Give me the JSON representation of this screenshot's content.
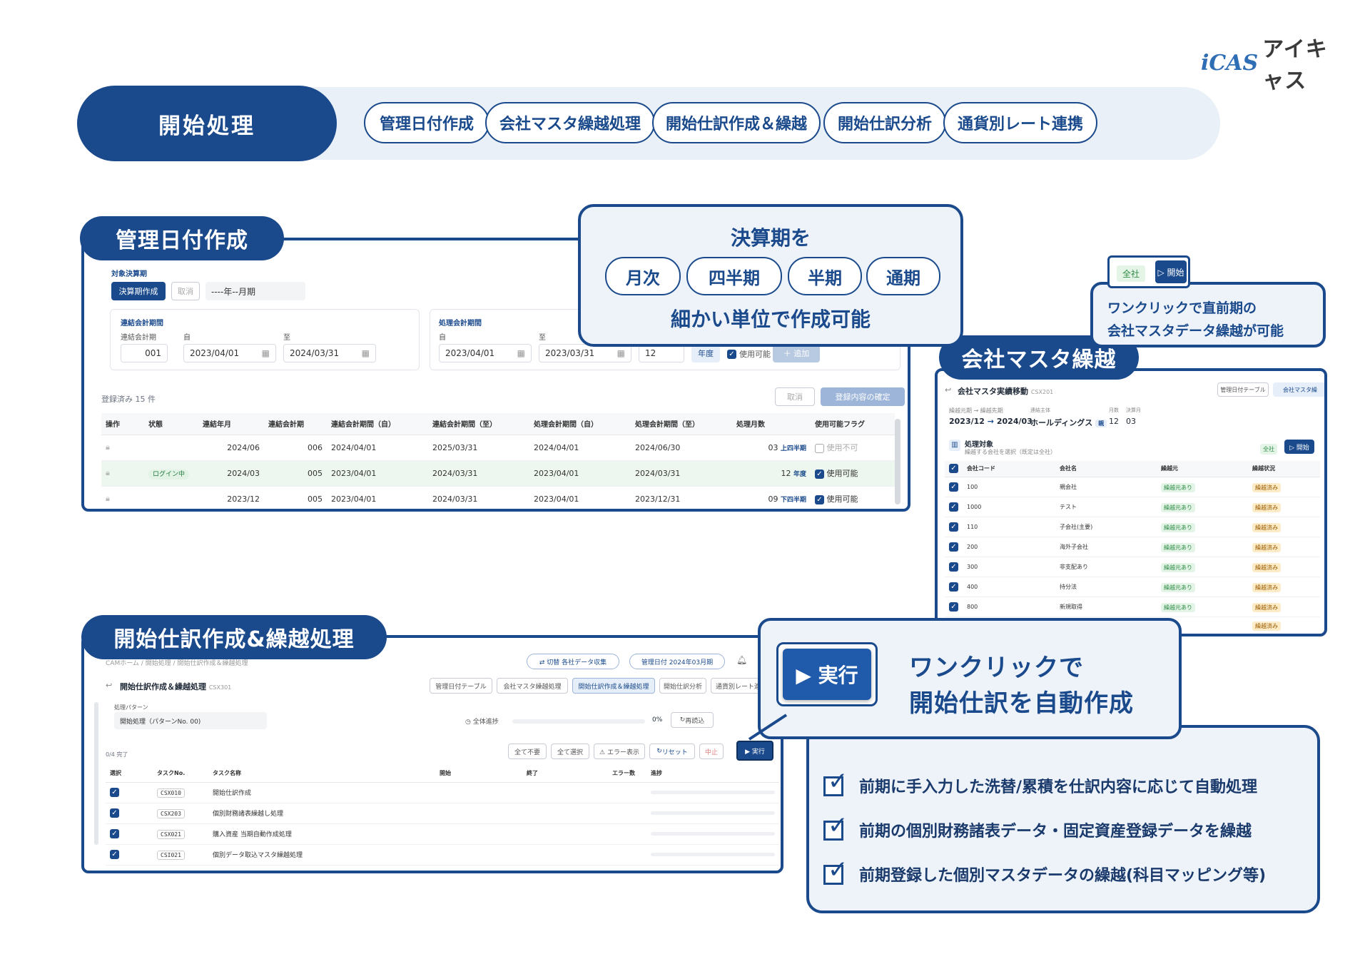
{
  "brand": {
    "mark": "iCAS",
    "name": "アイキャス"
  },
  "header": {
    "title": "開始処理",
    "tags": [
      "管理日付作成",
      "会社マスタ繰越処理",
      "開始仕訳作成＆繰越",
      "開始仕訳分析",
      "通貨別レート連携"
    ]
  },
  "s1": {
    "title": "管理日付作成",
    "target_label": "対象決算期",
    "create_btn": "決算期作成",
    "cancel_btn": "取消",
    "period_placeholder": "----年--月期",
    "consol_group": "連結会計期間",
    "consol_no_label": "連結会計期",
    "from_label": "自",
    "to_label": "至",
    "consol_no": "001",
    "consol_from": "2023/04/01",
    "consol_to": "2024/03/31",
    "proc_group": "処理会計期間",
    "proc_from": "2023/04/01",
    "proc_to": "2023/03/31",
    "months": "12",
    "year_btn": "年度",
    "usable_label": "使用可能",
    "add_btn": "＋ 追加",
    "count": "登録済み 15 件",
    "undo_btn": "取消",
    "confirm_btn": "登録内容の確定",
    "columns": [
      "操作",
      "状態",
      "連結年月",
      "連結会計期",
      "連結会計期間（自）",
      "連結会計期間（至）",
      "処理会計期間（自）",
      "処理会計期間（至）",
      "処理月数",
      "使用可能フラグ"
    ],
    "rows": [
      {
        "status": "",
        "ym": "2024/06",
        "no": "006",
        "cf": "2024/04/01",
        "ct": "2025/03/31",
        "pf": "2024/04/01",
        "pt": "2024/06/30",
        "m": "03",
        "unit": "上四半期",
        "flag": "使用不可",
        "on": false
      },
      {
        "status": "ログイン中",
        "ym": "2024/03",
        "no": "005",
        "cf": "2023/04/01",
        "ct": "2024/03/31",
        "pf": "2023/04/01",
        "pt": "2024/03/31",
        "m": "12",
        "unit": "年度",
        "flag": "使用可能",
        "on": true
      },
      {
        "status": "",
        "ym": "2023/12",
        "no": "005",
        "cf": "2023/04/01",
        "ct": "2024/03/31",
        "pf": "2023/04/01",
        "pt": "2023/12/31",
        "m": "09",
        "unit": "下四半期",
        "flag": "使用可能",
        "on": true
      }
    ]
  },
  "callout1": {
    "top": "決算期を",
    "units": [
      "月次",
      "四半期",
      "半期",
      "通期"
    ],
    "bottom": "細かい単位で作成可能"
  },
  "s2": {
    "title": "会社マスタ繰越",
    "mini_all": "全社",
    "mini_start": "▷ 開始",
    "note_line1": "ワンクリックで直前期の",
    "note_line2": "会社マスタデータ繰越が可能",
    "screen_title": "会社マスタ実績移動",
    "screen_code": "CSX201",
    "tabs": [
      "管理日付テーブル",
      "会社マスタ繰"
    ],
    "src_label": "繰越元期 → 繰越先期",
    "src_from": "2023/12",
    "arrow": "→",
    "src_to": "2024/03",
    "entity_label": "連結主体",
    "entity": "ホールディングス",
    "entity_tag": "親",
    "months_label": "月数",
    "months": "12",
    "fy_label": "決算月",
    "fy": "03",
    "target_title": "処理対象",
    "target_sub": "繰越する会社を選択（既定は全社）",
    "all_badge": "全社",
    "start_btn": "▷ 開始",
    "columns": [
      "会社コード",
      "会社名",
      "繰越元",
      "繰越状況"
    ],
    "rows": [
      {
        "code": "100",
        "name": "親会社",
        "src": "繰越元あり",
        "st": "繰越済み"
      },
      {
        "code": "1000",
        "name": "テスト",
        "src": "繰越元あり",
        "st": "繰越済み"
      },
      {
        "code": "110",
        "name": "子会社(主要)",
        "src": "繰越元あり",
        "st": "繰越済み"
      },
      {
        "code": "200",
        "name": "海外子会社",
        "src": "繰越元あり",
        "st": "繰越済み"
      },
      {
        "code": "300",
        "name": "非支配あり",
        "src": "繰越元あり",
        "st": "繰越済み"
      },
      {
        "code": "400",
        "name": "持分法",
        "src": "繰越元あり",
        "st": "繰越済み"
      },
      {
        "code": "800",
        "name": "新規取得",
        "src": "繰越元あり",
        "st": "繰越済み"
      }
    ],
    "extra_status": "繰越済み"
  },
  "s3": {
    "title": "開始仕訳作成&繰越処理",
    "breadcrumb": "CAMホーム / 開始処理 / 開始仕訳作成＆繰越処理",
    "switch_btn": "⇄ 切替  各社データ収集",
    "mgmt_btn": "管理日付  2024年03月期",
    "screen_title": "開始仕訳作成＆繰越処理",
    "screen_code": "CSX301",
    "tabs": [
      "管理日付テーブル",
      "会社マスタ繰越処理",
      "開始仕訳作成＆繰越処理",
      "開始仕訳分析",
      "通貨別レート連"
    ],
    "pattern_label": "処理パターン",
    "pattern": "開始処理（パターンNo. 00)",
    "progress_label": "全体進捗",
    "progress": "0%",
    "reload_btn": "再読込",
    "done": "0/4 完了",
    "btns": [
      "全て不要",
      "全て選択",
      "⚠ エラー表示",
      "リセット",
      "中止",
      "▶ 実行"
    ],
    "columns": [
      "選択",
      "タスクNo.",
      "タスク名称",
      "開始",
      "終了",
      "エラー数",
      "進捗"
    ],
    "rows": [
      {
        "no": "CSX010",
        "name": "開始仕訳作成"
      },
      {
        "no": "CSX203",
        "name": "個別財務諸表繰越し処理"
      },
      {
        "no": "CSX021",
        "name": "購入資産 当期自動作成処理"
      },
      {
        "no": "CSI021",
        "name": "個別データ取込マスタ繰越処理"
      }
    ]
  },
  "callout3": {
    "exec": "▶ 実行",
    "line1": "ワンクリックで",
    "line2": "開始仕訳を自動作成"
  },
  "bullets": [
    "前期に手入力した洗替/累積を仕訳内容に応じて自動処理",
    "前期の個別財務諸表データ・固定資産登録データを繰越",
    "前期登録した個別マスタデータの繰越(科目マッピング等)"
  ]
}
